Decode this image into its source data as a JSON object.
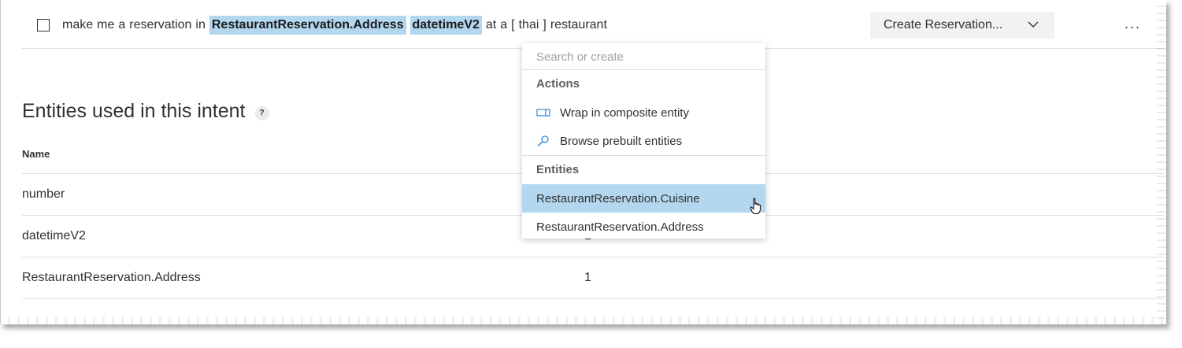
{
  "utterance": {
    "tokens_before": [
      "make",
      "me",
      "a",
      "reservation",
      "in"
    ],
    "entity_1": "RestaurantReservation.Address",
    "entity_2": "datetimeV2",
    "tokens_after": [
      "at",
      "a",
      "[",
      "thai",
      "]",
      "restaurant"
    ]
  },
  "intent_select": {
    "label": "Create Reservation..."
  },
  "more_label": "...",
  "section": {
    "title": "Entities used in this intent",
    "help": "?"
  },
  "table": {
    "header_name": "Name",
    "rows": [
      {
        "name": "number",
        "count": ""
      },
      {
        "name": "datetimeV2",
        "count": "1"
      },
      {
        "name": "RestaurantReservation.Address",
        "count": "1"
      }
    ]
  },
  "dropdown": {
    "search_placeholder": "Search or create",
    "actions_label": "Actions",
    "actions": [
      {
        "label": "Wrap in composite entity",
        "icon": "composite-entity-icon"
      },
      {
        "label": "Browse prebuilt entities",
        "icon": "search-icon"
      }
    ],
    "entities_label": "Entities",
    "entities": [
      {
        "label": "RestaurantReservation.Cuisine",
        "selected": true
      },
      {
        "label": "RestaurantReservation.Address",
        "selected": false
      }
    ]
  },
  "colors": {
    "entity_highlight": "#b3d7ef",
    "selected_item": "#b3d7ef",
    "button_bg": "#f3f2f1",
    "divider": "#e1dfdd"
  }
}
